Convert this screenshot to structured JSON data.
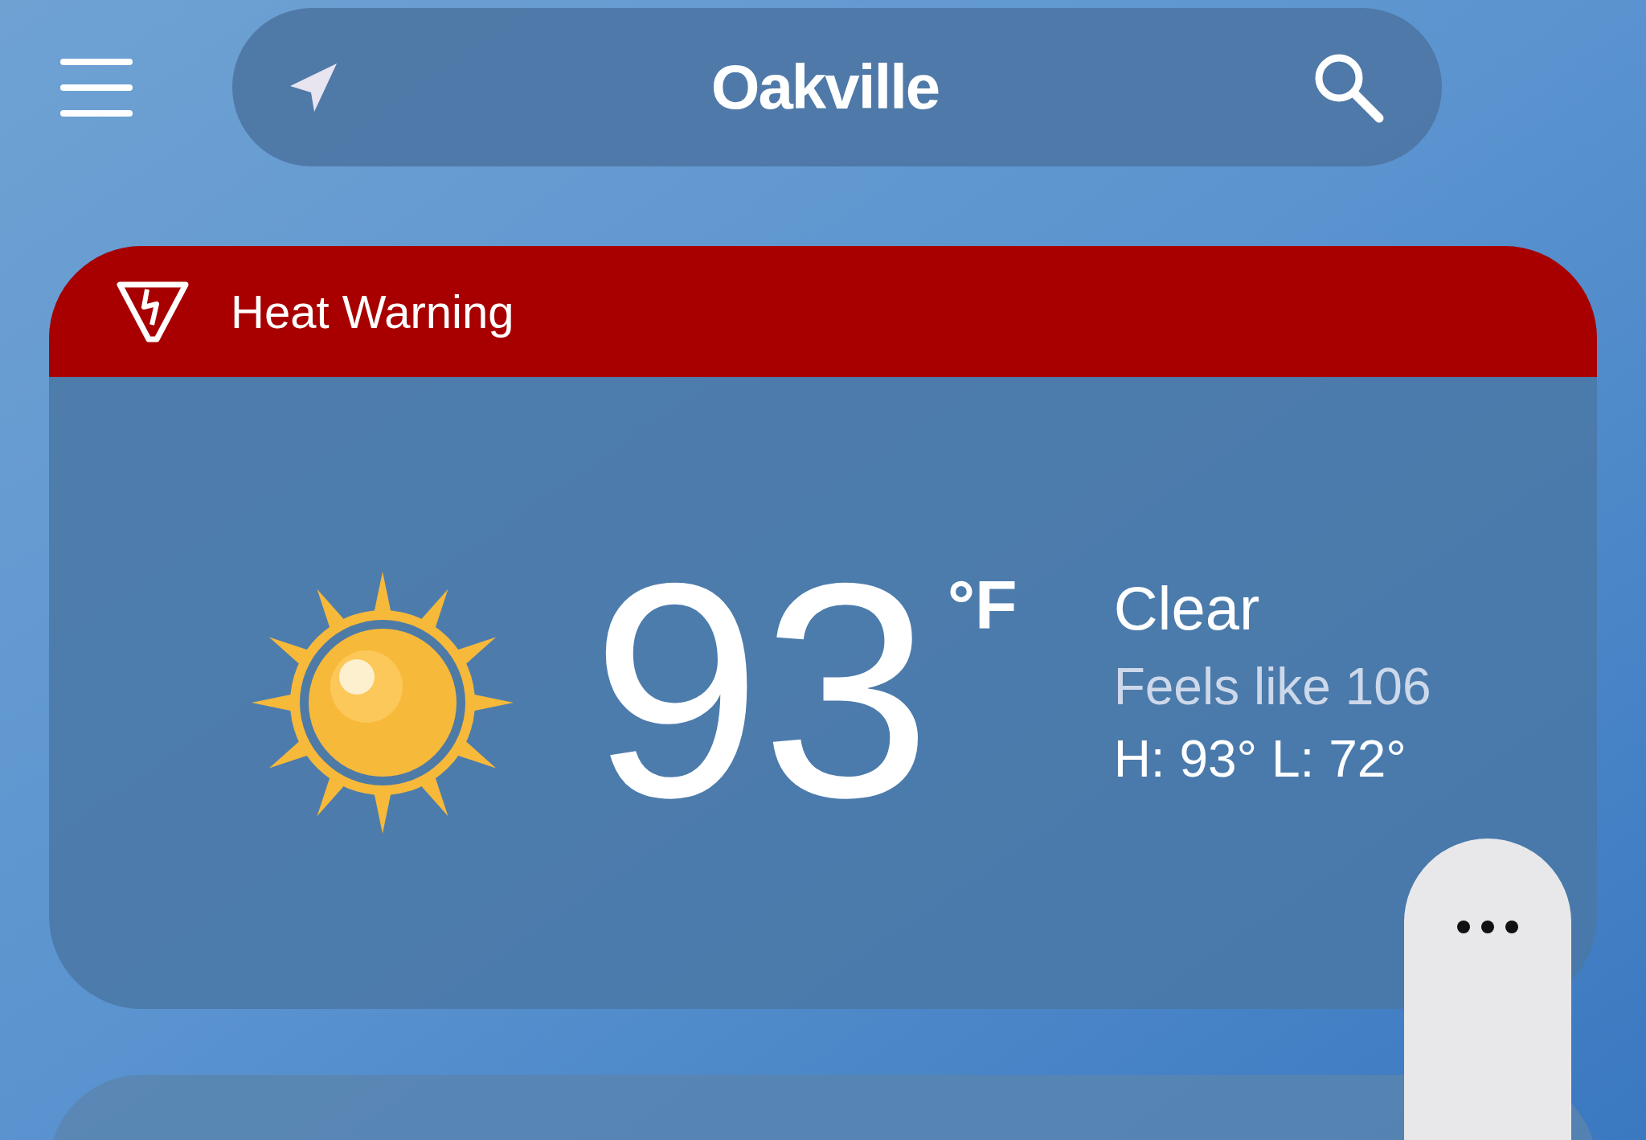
{
  "header": {
    "title": "Oakville"
  },
  "alert": {
    "label": "Heat Warning"
  },
  "current": {
    "temperature": "93",
    "unit": "°F",
    "condition": "Clear",
    "feels_like": "Feels like 106",
    "high_low": "H: 93° L: 72°"
  }
}
